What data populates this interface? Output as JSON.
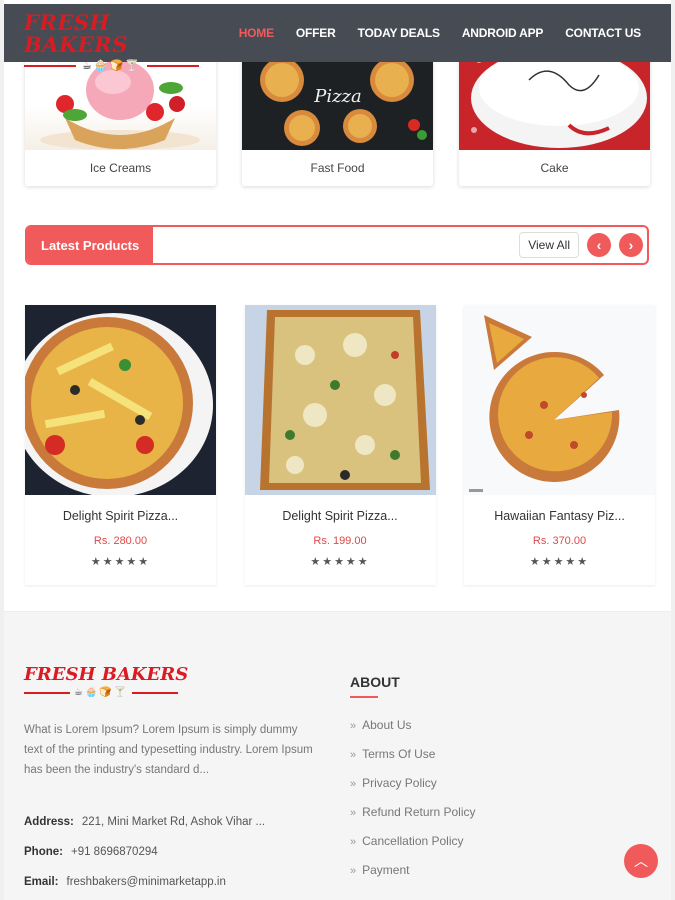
{
  "header": {
    "logo": "FRESH BAKERS",
    "logo_icons": "☕🧁🍞🍸",
    "nav": [
      "HOME",
      "OFFER",
      "TODAY DEALS",
      "ANDROID APP",
      "CONTACT US"
    ]
  },
  "categories": [
    {
      "label": "Ice Creams",
      "image": "ice-cream-sundae"
    },
    {
      "label": "Fast Food",
      "image": "pizzas-chalkboard"
    },
    {
      "label": "Cake",
      "image": "white-cake"
    }
  ],
  "fastfood_sign": "Pizza",
  "latest": {
    "title": "Latest Products",
    "view_all": "View All",
    "prev_icon": "chevron-left-icon",
    "next_icon": "chevron-right-icon"
  },
  "products": [
    {
      "name": "Delight Spirit Pizza...",
      "price": "Rs. 280.00",
      "stars": "★★★★★"
    },
    {
      "name": "Delight Spirit Pizza...",
      "price": "Rs. 199.00",
      "stars": "★★★★★"
    },
    {
      "name": "Hawaiian Fantasy Piz...",
      "price": "Rs. 370.00",
      "stars": "★★★★★"
    }
  ],
  "footer": {
    "logo": "FRESH BAKERS",
    "logo_icons": "☕🧁🍞🍸",
    "description": "What is Lorem Ipsum? Lorem Ipsum is simply dummy text of the printing and typesetting industry. Lorem Ipsum has been the industry's standard d...",
    "address_label": "Address:",
    "address": "221, Mini Market Rd, Ashok Vihar ...",
    "phone_label": "Phone:",
    "phone": "+91 8696870294",
    "email_label": "Email:",
    "email": "freshbakers@minimarketapp.in",
    "about_title": "ABOUT",
    "about_links": [
      "About Us",
      "Terms Of Use",
      "Privacy Policy",
      "Refund Return Policy",
      "Cancellation Policy",
      "Payment"
    ]
  },
  "colors": {
    "accent": "#f05a5a",
    "header_bg": "#474c54",
    "logo_red": "#d91b22"
  }
}
